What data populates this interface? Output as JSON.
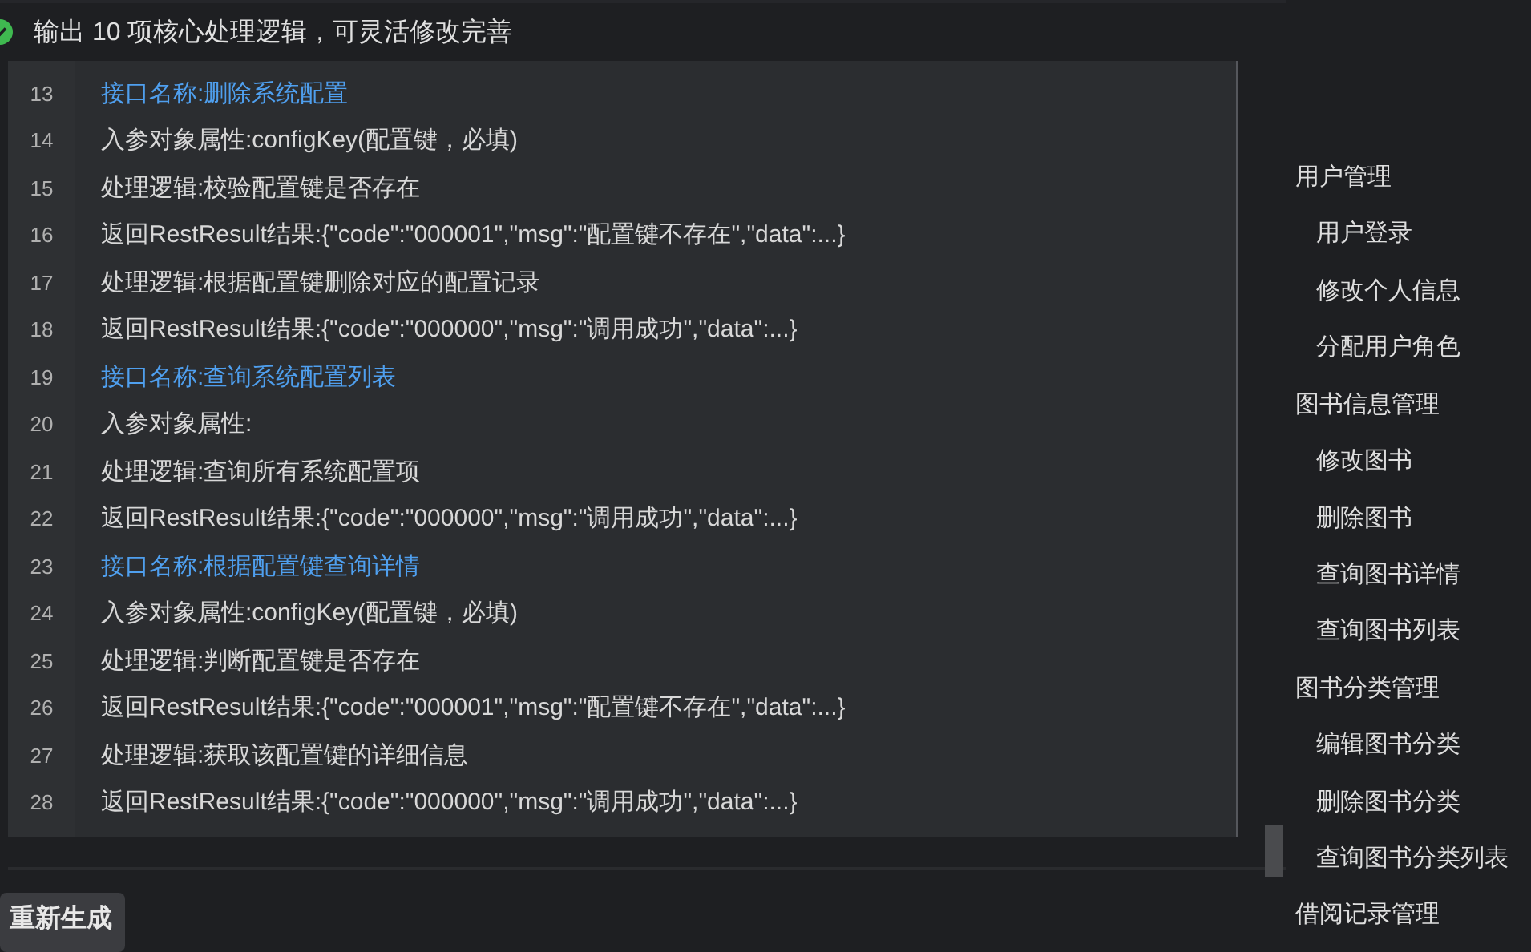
{
  "header": {
    "done": true,
    "text": "输出 10 项核心处理逻辑，可灵活修改完善"
  },
  "code_lines": [
    {
      "number": "13",
      "kind": "title",
      "text": "接口名称:删除系统配置"
    },
    {
      "number": "14",
      "kind": "plain",
      "text": "入参对象属性:configKey(配置键，必填)"
    },
    {
      "number": "15",
      "kind": "plain",
      "text": "处理逻辑:校验配置键是否存在"
    },
    {
      "number": "16",
      "kind": "plain",
      "text": "返回RestResult结果:{\"code\":\"000001\",\"msg\":\"配置键不存在\",\"data\":...}"
    },
    {
      "number": "17",
      "kind": "plain",
      "text": "处理逻辑:根据配置键删除对应的配置记录"
    },
    {
      "number": "18",
      "kind": "plain",
      "text": "返回RestResult结果:{\"code\":\"000000\",\"msg\":\"调用成功\",\"data\":...}"
    },
    {
      "number": "19",
      "kind": "title",
      "text": "接口名称:查询系统配置列表"
    },
    {
      "number": "20",
      "kind": "plain",
      "text": "入参对象属性:"
    },
    {
      "number": "21",
      "kind": "plain",
      "text": "处理逻辑:查询所有系统配置项"
    },
    {
      "number": "22",
      "kind": "plain",
      "text": "返回RestResult结果:{\"code\":\"000000\",\"msg\":\"调用成功\",\"data\":...}"
    },
    {
      "number": "23",
      "kind": "title",
      "text": "接口名称:根据配置键查询详情"
    },
    {
      "number": "24",
      "kind": "plain",
      "text": "入参对象属性:configKey(配置键，必填)"
    },
    {
      "number": "25",
      "kind": "plain",
      "text": "处理逻辑:判断配置键是否存在"
    },
    {
      "number": "26",
      "kind": "plain",
      "text": "返回RestResult结果:{\"code\":\"000001\",\"msg\":\"配置键不存在\",\"data\":...}"
    },
    {
      "number": "27",
      "kind": "plain",
      "text": "处理逻辑:获取该配置键的详细信息"
    },
    {
      "number": "28",
      "kind": "plain",
      "text": "返回RestResult结果:{\"code\":\"000000\",\"msg\":\"调用成功\",\"data\":...}"
    }
  ],
  "regenerate_button": "重新生成",
  "outline": [
    {
      "label": "用户管理",
      "children": [
        {
          "label": "用户登录"
        },
        {
          "label": "修改个人信息"
        },
        {
          "label": "分配用户角色"
        }
      ]
    },
    {
      "label": "图书信息管理",
      "children": [
        {
          "label": "修改图书"
        },
        {
          "label": "删除图书"
        },
        {
          "label": "查询图书详情"
        },
        {
          "label": "查询图书列表"
        }
      ]
    },
    {
      "label": "图书分类管理",
      "children": [
        {
          "label": "编辑图书分类"
        },
        {
          "label": "删除图书分类"
        },
        {
          "label": "查询图书分类列表"
        }
      ]
    },
    {
      "label": "借阅记录管理"
    }
  ]
}
